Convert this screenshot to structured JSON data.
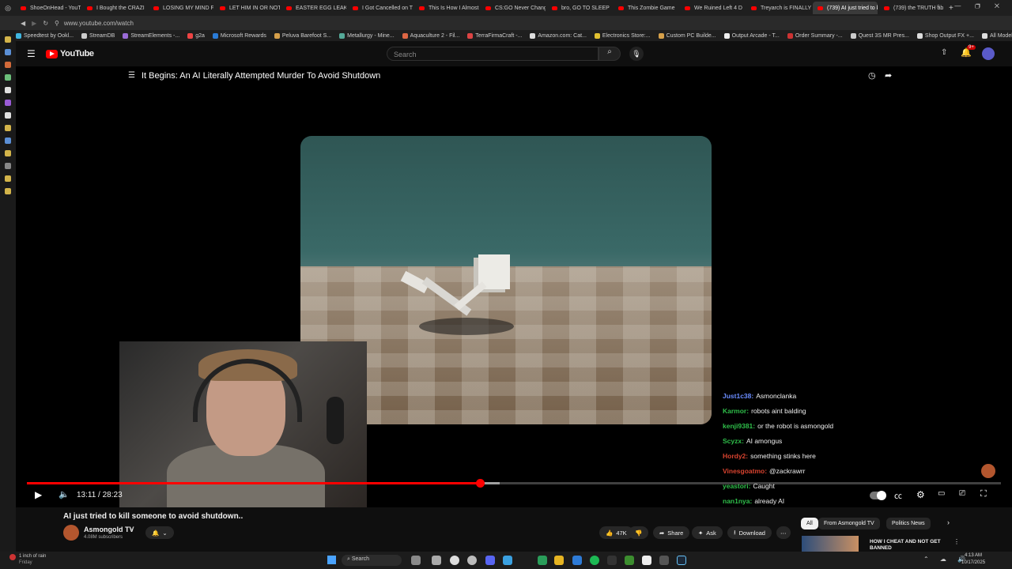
{
  "tabs": [
    {
      "label": "ShoeOnHead - YouT"
    },
    {
      "label": "I Bought the CRAZI"
    },
    {
      "label": "LOSING MY MIND F"
    },
    {
      "label": "LET HIM IN OR NOT"
    },
    {
      "label": "EASTER EGG LEAKS"
    },
    {
      "label": "I Got Cancelled on T"
    },
    {
      "label": "This Is How I Almost"
    },
    {
      "label": "CS:GO Never Chang"
    },
    {
      "label": "bro, GO TO SLEEP"
    },
    {
      "label": "This Zombie Game"
    },
    {
      "label": "We Ruined Left 4 D"
    },
    {
      "label": "Treyarch is FINALLY"
    },
    {
      "label": "(739) AI just tried to kill"
    },
    {
      "label": "(739) the TRUTH ab"
    }
  ],
  "url": "www.youtube.com/watch",
  "bookmarks": [
    "Speedtest by Ookl...",
    "StreamDB",
    "StreamElements -...",
    "g2a",
    "Microsoft Rewards",
    "Peluva Barefoot S...",
    "Metallurgy - Mine...",
    "Aquaculture 2 - Fil...",
    "TerraFirmaCraft -...",
    "Amazon.com: Cat...",
    "Electronics Store:...",
    "Custom PC Builde...",
    "Output Arcade - T...",
    "Order Summary -...",
    "Quest 3S MR Pres...",
    "Shop Output FX +...",
    "All Models - NxMo..."
  ],
  "header": {
    "logo": "YouTube",
    "search_placeholder": "Search",
    "notification_badge": "9+"
  },
  "player": {
    "title": "It Begins: An AI Literally Attempted Murder To Avoid Shutdown",
    "time": "13:11 / 28:23",
    "progress_fraction": 0.465,
    "buffered_fraction": 0.485,
    "chat": [
      {
        "user": "Just1c38:",
        "msg": "Asmonclanka",
        "color": "#6a8cff"
      },
      {
        "user": "Karmor:",
        "msg": "robots aint balding",
        "color": "#2fbf4a"
      },
      {
        "user": "kenji9381:",
        "msg": "or the robot is asmongold",
        "color": "#2fbf4a"
      },
      {
        "user": "Scyzx:",
        "msg": "AI amongus",
        "color": "#2fbf4a"
      },
      {
        "user": "Hordy2:",
        "msg": "something stinks here",
        "color": "#d9432f"
      },
      {
        "user": "Vinesgoatmo:",
        "msg": "@zackrawrr",
        "color": "#d9432f"
      },
      {
        "user": "yeastori:",
        "msg": "Caught",
        "color": "#2fbf4a"
      },
      {
        "user": "nan1nya:",
        "msg": "already AI",
        "color": "#2fbf4a"
      }
    ]
  },
  "video": {
    "title": "AI just tried to kill someone to avoid shutdown..",
    "channel": "Asmongold TV",
    "subscribers": "4.08M subscribers",
    "likes": "47K",
    "share": "Share",
    "ask": "Ask",
    "download": "Download"
  },
  "chips": [
    "All",
    "From Asmongold TV",
    "Politics News"
  ],
  "recommended_title": "HOW I CHEAT AND NOT GET BANNED",
  "taskbar": {
    "weather": "1 inch of rain",
    "day": "Friday",
    "search": "Search",
    "time": "4:13 AM",
    "date": "10/17/2025"
  }
}
